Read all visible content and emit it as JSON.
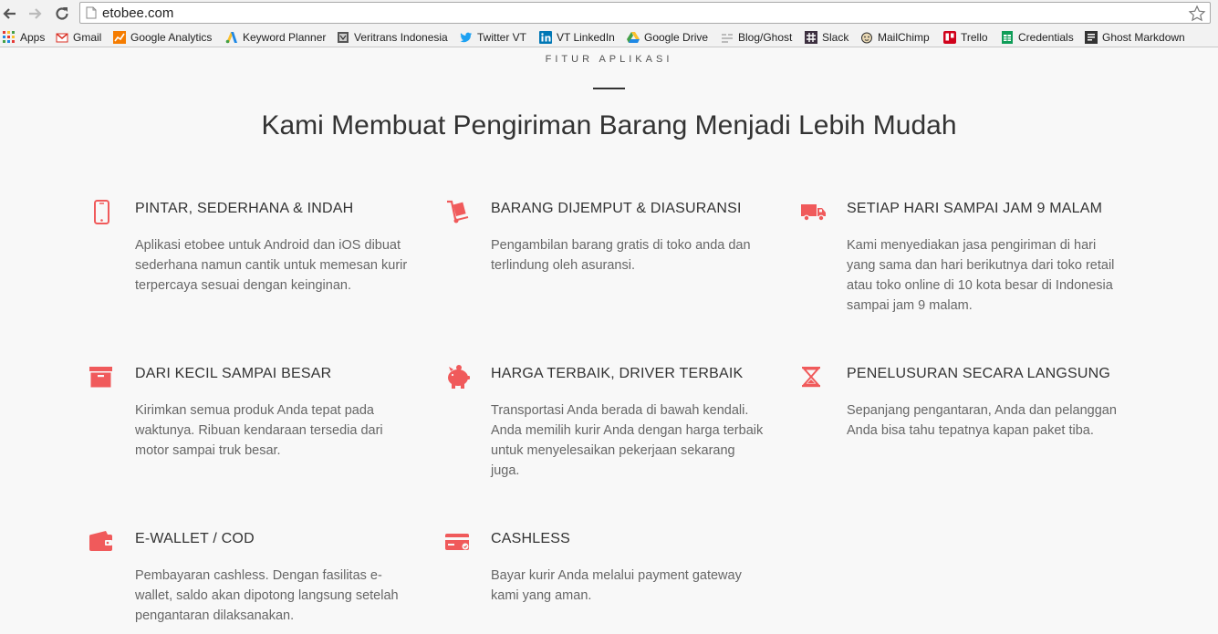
{
  "browser": {
    "url": "etobee.com",
    "bookmarks": [
      {
        "label": "Apps",
        "icon": "apps-grid-icon"
      },
      {
        "label": "Gmail",
        "icon": "gmail-icon"
      },
      {
        "label": "Google Analytics",
        "icon": "analytics-icon"
      },
      {
        "label": "Keyword Planner",
        "icon": "adwords-icon"
      },
      {
        "label": "Veritrans Indonesia",
        "icon": "veritrans-icon"
      },
      {
        "label": "Twitter VT",
        "icon": "twitter-icon"
      },
      {
        "label": "VT LinkedIn",
        "icon": "linkedin-icon"
      },
      {
        "label": "Google Drive",
        "icon": "drive-icon"
      },
      {
        "label": "Blog/Ghost",
        "icon": "ghost-icon"
      },
      {
        "label": "Slack",
        "icon": "slack-icon"
      },
      {
        "label": "MailChimp",
        "icon": "mailchimp-icon"
      },
      {
        "label": "Trello",
        "icon": "trello-icon"
      },
      {
        "label": "Credentials",
        "icon": "sheets-icon"
      },
      {
        "label": "Ghost Markdown",
        "icon": "markdown-icon"
      }
    ]
  },
  "section": {
    "eyebrow": "FITUR APLIKASI",
    "headline": "Kami Membuat Pengiriman Barang Menjadi Lebih Mudah"
  },
  "accent_color": "#f05a5b",
  "features": [
    {
      "icon": "smartphone-icon",
      "title": "PINTAR, SEDERHANA & INDAH",
      "desc": "Aplikasi etobee untuk Android dan iOS dibuat sederhana namun cantik untuk memesan kurir terpercaya sesuai dengan keinginan."
    },
    {
      "icon": "hand-truck-icon",
      "title": "BARANG DIJEMPUT & DIASURANSI",
      "desc": "Pengambilan barang gratis di toko anda dan terlindung oleh asuransi."
    },
    {
      "icon": "delivery-truck-icon",
      "title": "SETIAP HARI SAMPAI JAM 9 MALAM",
      "desc": "Kami menyediakan jasa pengiriman di hari yang sama dan hari berikutnya dari toko retail atau toko online di 10 kota besar di Indonesia sampai jam 9 malam."
    },
    {
      "icon": "archive-box-icon",
      "title": "DARI KECIL SAMPAI BESAR",
      "desc": "Kirimkan semua produk Anda tepat pada waktunya. Ribuan kendaraan tersedia dari motor sampai truk besar."
    },
    {
      "icon": "piggy-bank-icon",
      "title": "HARGA TERBAIK, DRIVER TERBAIK",
      "desc": "Transportasi Anda berada di bawah kendali. Anda memilih kurir Anda dengan harga terbaik untuk menyelesaikan pekerjaan sekarang juga."
    },
    {
      "icon": "hourglass-icon",
      "title": "PENELUSURAN SECARA LANGSUNG",
      "desc": "Sepanjang pengantaran, Anda dan pelanggan Anda bisa tahu tepatnya kapan paket tiba."
    },
    {
      "icon": "wallet-icon",
      "title": "E-WALLET / COD",
      "desc": "Pembayaran cashless. Dengan fasilitas e-wallet, saldo akan dipotong langsung setelah pengantaran dilaksanakan."
    },
    {
      "icon": "credit-card-icon",
      "title": "CASHLESS",
      "desc": "Bayar kurir Anda melalui payment gateway kami yang aman."
    }
  ]
}
